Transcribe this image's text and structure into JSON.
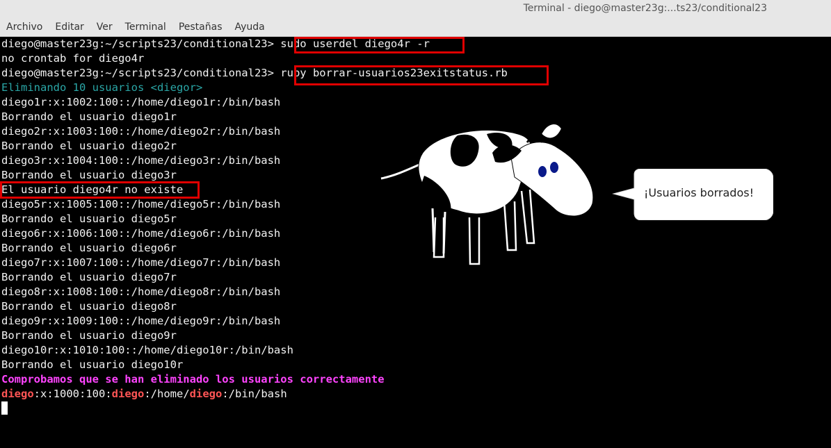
{
  "window": {
    "title": "Terminal - diego@master23g:...ts23/conditional23"
  },
  "menubar": {
    "items": [
      "Archivo",
      "Editar",
      "Ver",
      "Terminal",
      "Pestañas",
      "Ayuda"
    ]
  },
  "terminal": {
    "prompt": "diego@master23g:~/scripts23/conditional23>",
    "commands": [
      "sudo userdel diego4r -r",
      "ruby borrar-usuarios23exitstatus.rb"
    ],
    "output_crontab": "no crontab for diego4r",
    "info": "Eliminando 10 usuarios <diegor>",
    "lines": [
      "diego1r:x:1002:100::/home/diego1r:/bin/bash",
      "Borrando el usuario diego1r",
      "diego2r:x:1003:100::/home/diego2r:/bin/bash",
      "Borrando el usuario diego2r",
      "diego3r:x:1004:100::/home/diego3r:/bin/bash",
      "Borrando el usuario diego3r",
      "El usuario diego4r no existe",
      "diego5r:x:1005:100::/home/diego5r:/bin/bash",
      "Borrando el usuario diego5r",
      "diego6r:x:1006:100::/home/diego6r:/bin/bash",
      "Borrando el usuario diego6r",
      "diego7r:x:1007:100::/home/diego7r:/bin/bash",
      "Borrando el usuario diego7r",
      "diego8r:x:1008:100::/home/diego8r:/bin/bash",
      "Borrando el usuario diego8r",
      "diego9r:x:1009:100::/home/diego9r:/bin/bash",
      "Borrando el usuario diego9r",
      "diego10r:x:1010:100::/home/diego10r:/bin/bash",
      "Borrando el usuario diego10r"
    ],
    "check_message": "Comprobamos que se han eliminado los usuarios correctamente",
    "passwd_line": {
      "p1": "diego",
      "p2": ":x:1000:100:",
      "p3": "diego",
      "p4": ":/home/",
      "p5": "diego",
      "p6": ":/bin/bash"
    }
  },
  "bubble": {
    "text": "¡Usuarios borrados!"
  },
  "colors": {
    "highlight": "#e00000",
    "info": "#2aa6a6",
    "check": "#ff44ff",
    "user_name": "#ff5555"
  }
}
